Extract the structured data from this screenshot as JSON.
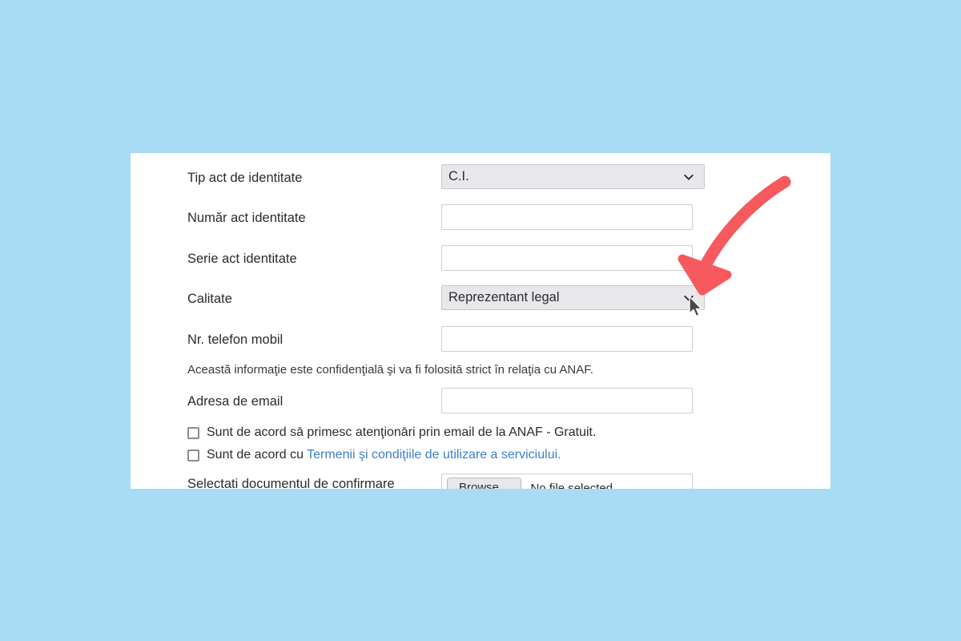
{
  "page": {
    "background_color": "#a8dcf4",
    "panel_background": "#ffffff"
  },
  "form": {
    "fields": [
      {
        "label": "Tip act de identitate",
        "type": "select",
        "value": "C.I."
      },
      {
        "label": "Număr act identitate",
        "type": "text",
        "value": "",
        "placeholder": ""
      },
      {
        "label": "Serie act identitate",
        "type": "text",
        "value": "",
        "placeholder": ""
      },
      {
        "label": "Calitate",
        "type": "select",
        "value": "Reprezentant legal"
      },
      {
        "label": "Nr. telefon mobil",
        "type": "text",
        "value": "",
        "placeholder": ""
      },
      {
        "label": "Adresa de email",
        "type": "text",
        "value": "",
        "placeholder": ""
      }
    ],
    "note": "Această informaţie este confidenţialā şi va fi folositā strict în relaţia cu ANAF.",
    "checkboxes": [
      {
        "checked": false,
        "text": "Sunt de acord sā primesc atenţionāri prin email de la ANAF - Gratuit.",
        "link_text": "",
        "text_after_link": ""
      },
      {
        "checked": false,
        "text": "Sunt de acord cu ",
        "link_text": "Termenii şi condiţiile de utilizare a serviciului.",
        "text_after_link": ""
      }
    ],
    "file_field": {
      "label": "Selectati documentul de confirmare",
      "button_label": "Browse...",
      "status": "No file selected."
    }
  },
  "annotation": {
    "arrow_color": "#f75a5e",
    "arrow_description": "curved-arrow-pointing-to-calitate-dropdown",
    "cursor_description": "mouse-pointer-on-calitate-dropdown"
  },
  "colors": {
    "background": "#a8dcf4",
    "link": "#3d7fcc",
    "select_fill": "#e8e8ec",
    "input_border": "#cfcfcf",
    "text": "#2b2b2b"
  }
}
